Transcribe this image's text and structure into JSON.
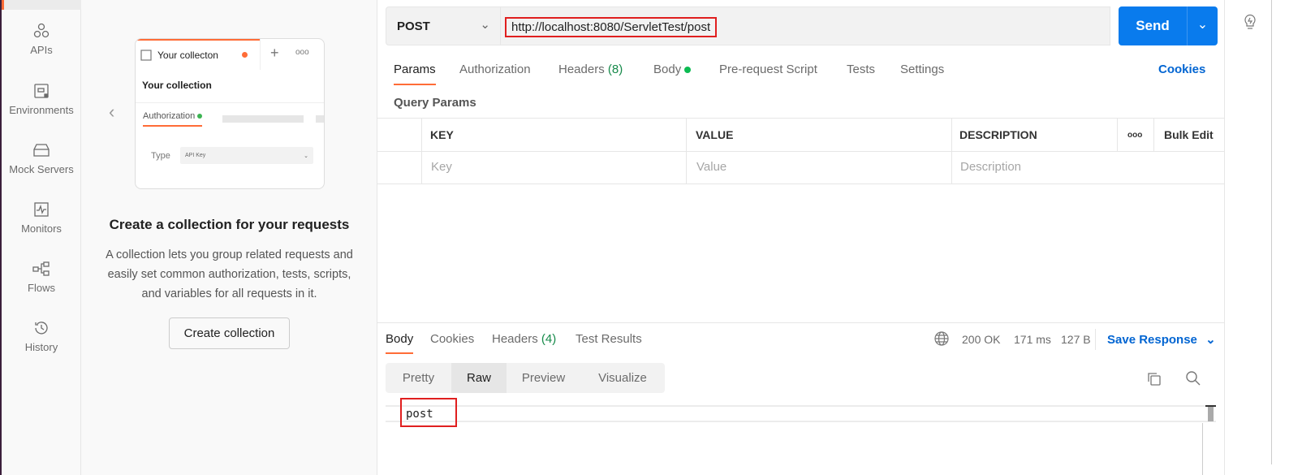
{
  "sidebar": {
    "items": [
      {
        "label": "APIs",
        "icon": "apis-icon"
      },
      {
        "label": "Environments",
        "icon": "environments-icon"
      },
      {
        "label": "Mock Servers",
        "icon": "mock-servers-icon"
      },
      {
        "label": "Monitors",
        "icon": "monitors-icon"
      },
      {
        "label": "Flows",
        "icon": "flows-icon"
      },
      {
        "label": "History",
        "icon": "history-icon"
      }
    ]
  },
  "collection_panel": {
    "card": {
      "tab": "Your collecton",
      "name": "Your collection",
      "auth_tab": "Authorization",
      "type_label": "Type",
      "type_value": "API Key"
    },
    "title": "Create a collection for your requests",
    "desc": [
      "A collection lets you group related requests and",
      "easily set common authorization, tests, scripts,",
      "and variables for all requests in it."
    ],
    "button": "Create collection"
  },
  "request": {
    "method": "POST",
    "url": "http://localhost:8080/ServletTest/post",
    "send": "Send",
    "tabs": {
      "params": "Params",
      "authorization": "Authorization",
      "headers": "Headers",
      "headers_count": "(8)",
      "body": "Body",
      "prerequest": "Pre-request Script",
      "tests": "Tests",
      "settings": "Settings"
    },
    "cookies": "Cookies",
    "query_params": "Query Params",
    "table": {
      "headers": [
        "KEY",
        "VALUE",
        "DESCRIPTION"
      ],
      "bulk_edit": "Bulk Edit",
      "placeholders": [
        "Key",
        "Value",
        "Description"
      ]
    }
  },
  "response": {
    "tabs": {
      "body": "Body",
      "cookies": "Cookies",
      "headers": "Headers",
      "headers_count": "(4)",
      "test_results": "Test Results"
    },
    "status": "200 OK",
    "time": "171 ms",
    "size": "127 B",
    "save": "Save Response",
    "views": [
      "Pretty",
      "Raw",
      "Preview",
      "Visualize"
    ],
    "active_view": "Raw",
    "body": "post"
  },
  "colors": {
    "accent": "#ff6c37",
    "send": "#097bed",
    "status": "#168a4a",
    "link": "#0265d2"
  }
}
